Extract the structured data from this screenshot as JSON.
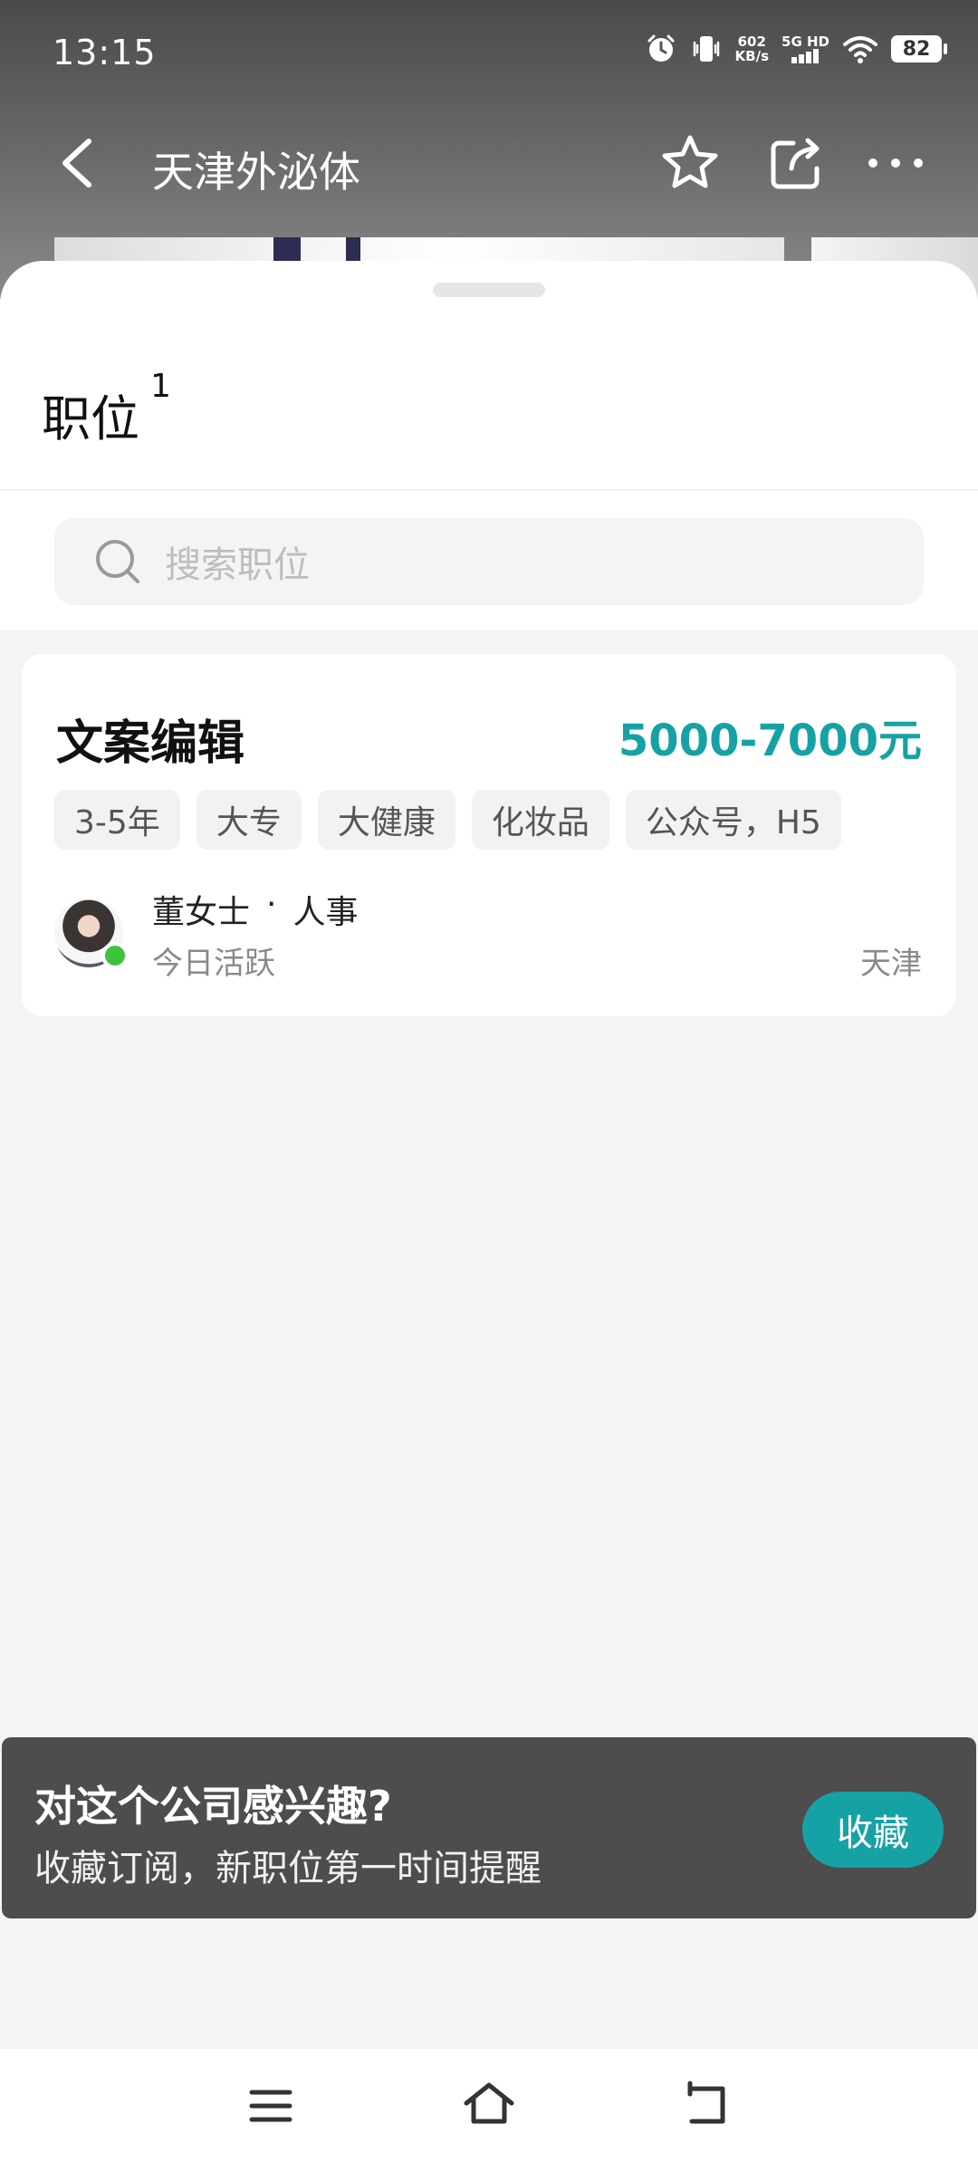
{
  "status_bar": {
    "time": "13:15",
    "net_speed_value": "602",
    "net_speed_unit": "KB/s",
    "network": "5G HD",
    "battery": "82"
  },
  "nav": {
    "title": "天津外泌体"
  },
  "section": {
    "title": "职位",
    "count": "1"
  },
  "search": {
    "placeholder": "搜索职位"
  },
  "job": {
    "title": "文案编辑",
    "salary": "5000-7000元",
    "tags": [
      "3-5年",
      "大专",
      "大健康",
      "化妆品",
      "公众号，H5"
    ],
    "recruiter_name": "董女士",
    "separator": "·",
    "recruiter_role": "人事",
    "active_status": "今日活跃",
    "city": "天津"
  },
  "follow_banner": {
    "title": "对这个公司感兴趣?",
    "subtitle": "收藏订阅，新职位第一时间提醒",
    "button_label": "收藏"
  },
  "colors": {
    "accent": "#16a2a4",
    "online": "#3ec33e",
    "banner_bg": "#4d4d4d"
  }
}
